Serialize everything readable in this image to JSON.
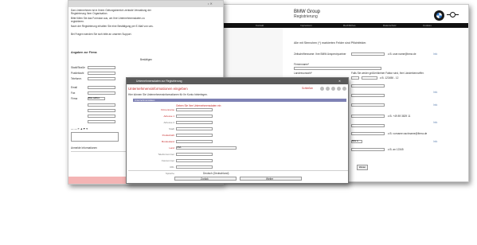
{
  "bmw_window": {
    "brand_title": "BMW Group",
    "brand_subtitle": "Registrierung",
    "intro_text": "Alle mit Sternchen (*) markierten Felder sind Pflichtfelder.",
    "support_label": "Zeitschriftenname: Ihre BMW Ansprechpartner",
    "support_value": "z.B. user.name@bmw.de",
    "org_label": "Firmenname*",
    "country_label": "Landesvorwahl*",
    "country_value": "Falls Sie weder größer/kleiner Faktor sind, Ihre Länderkennziffer.",
    "area_example": "z.B. 123456 - 12",
    "phone_example": "z.B. +49 89 3829 11",
    "email_example": "z.B. vorname.nachname@firma.de",
    "zip_example": "z.B. an 12345",
    "select_value": "Bitte w",
    "submit_label": "Weiter",
    "info_label": "Info",
    "links": [
      "Kontakt",
      "Impressum",
      "Rechtliches",
      "Datenschutz",
      "Cookies"
    ]
  },
  "left_window": {
    "para1": "Das Unternehmen ist in Ihrem Geltungsbereich zentrale Verwaltung der Registrierung Ihrer Organisation.",
    "para2": "Bitte füllen Sie das Formular aus, um Ihre Unternehmensdaten zu registrieren.",
    "para3": "Nach der Registrierung erhalten Sie eine Bestätigung per E-Mail von uns.",
    "para4": "Bei Fragen wenden Sie sich bitte an unseren Support.",
    "section_title": "Angaben zur Firma",
    "right_note": "Bestätigen",
    "fields": [
      "Stadt/Straße",
      "Postleitzahl",
      "Telefonnr.",
      "Email",
      "Fax",
      "Firma"
    ],
    "select_value": "Bitte wählen",
    "bottom_note": "Anmelde Informationen"
  },
  "modal": {
    "title": "Unternehmensdaten zur Registrierung",
    "heading": "Unternehmensinformationen eingeben",
    "close_label": "Schließen",
    "description": "Hier können Sie Unternehmensinformationen für Ihr Konto hinterlegen.",
    "bar_label": "Unternehmensdaten",
    "section_label": "Geben Sie Ihre Unternehmensdaten ein",
    "fields": [
      "Firmenname",
      "Adresse 1",
      "Adresse 2",
      "Stadt",
      "Postleitzahl",
      "Bundesland",
      "Land"
    ],
    "optional_fields": [
      "Telefonnummer",
      "Faxnummer",
      "URL"
    ],
    "country_value": "USA",
    "footer_label": "Sprache",
    "footer_value": "Deutsch (Deutschland)",
    "back_label": "Zurück",
    "next_label": "Weiter"
  }
}
